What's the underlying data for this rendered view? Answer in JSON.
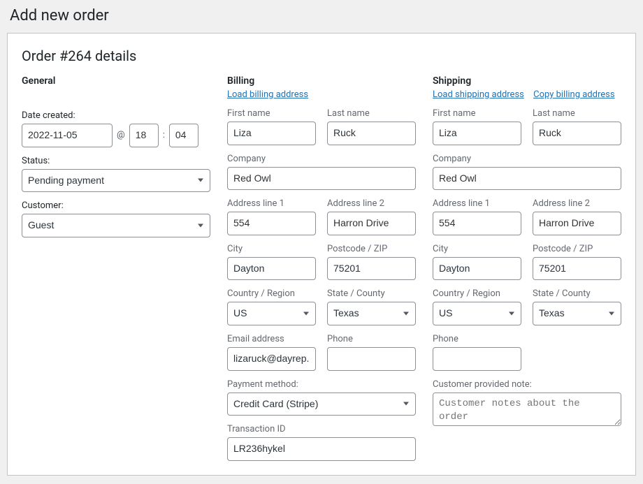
{
  "page_title": "Add new order",
  "panel_title": "Order #264 details",
  "general": {
    "title": "General",
    "date_label": "Date created:",
    "date": "2022-11-05",
    "at": "@",
    "hour": "18",
    "colon": ":",
    "minute": "04",
    "status_label": "Status:",
    "status_value": "Pending payment",
    "customer_label": "Customer:",
    "customer_value": "Guest"
  },
  "billing": {
    "title": "Billing",
    "load_link": "Load billing address",
    "first_name_label": "First name",
    "first_name": "Liza",
    "last_name_label": "Last name",
    "last_name": "Ruck",
    "company_label": "Company",
    "company": "Red Owl",
    "addr1_label": "Address line 1",
    "addr1": "554",
    "addr2_label": "Address line 2",
    "addr2": "Harron Drive",
    "city_label": "City",
    "city": "Dayton",
    "postcode_label": "Postcode / ZIP",
    "postcode": "75201",
    "country_label": "Country / Region",
    "country": "US",
    "state_label": "State / County",
    "state": "Texas",
    "email_label": "Email address",
    "email": "lizaruck@dayrep.com",
    "phone_label": "Phone",
    "phone": "",
    "payment_label": "Payment method:",
    "payment": "Credit Card (Stripe)",
    "txn_label": "Transaction ID",
    "txn": "LR236hykel"
  },
  "shipping": {
    "title": "Shipping",
    "load_link": "Load shipping address",
    "copy_link": "Copy billing address",
    "first_name_label": "First name",
    "first_name": "Liza",
    "last_name_label": "Last name",
    "last_name": "Ruck",
    "company_label": "Company",
    "company": "Red Owl",
    "addr1_label": "Address line 1",
    "addr1": "554",
    "addr2_label": "Address line 2",
    "addr2": "Harron Drive",
    "city_label": "City",
    "city": "Dayton",
    "postcode_label": "Postcode / ZIP",
    "postcode": "75201",
    "country_label": "Country / Region",
    "country": "US",
    "state_label": "State / County",
    "state": "Texas",
    "phone_label": "Phone",
    "phone": "",
    "note_label": "Customer provided note:",
    "note_placeholder": "Customer notes about the order",
    "note": ""
  }
}
